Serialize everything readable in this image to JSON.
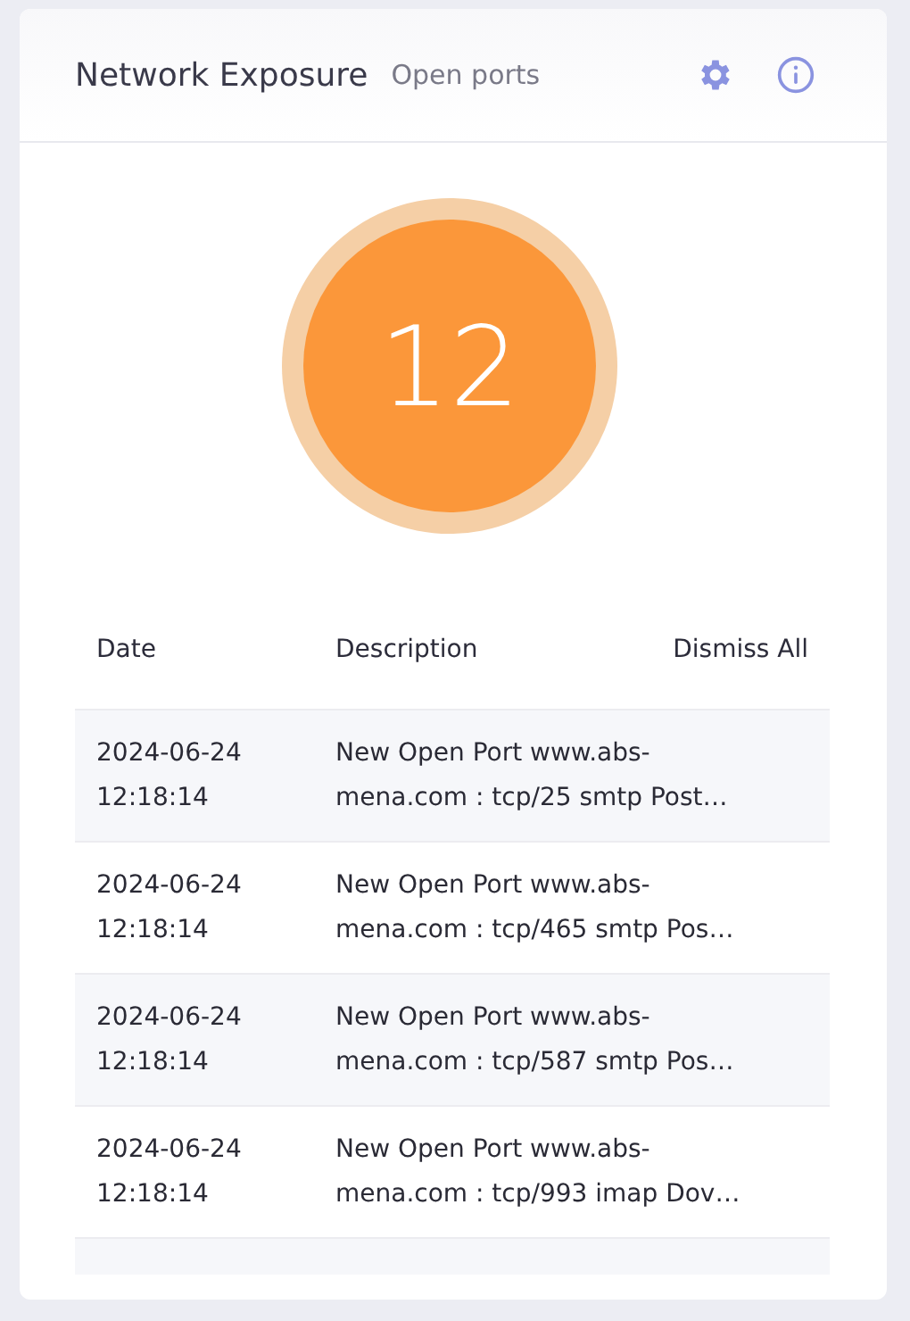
{
  "header": {
    "title": "Network Exposure",
    "subtitle": "Open ports"
  },
  "counter": {
    "value": "12"
  },
  "table": {
    "columns": [
      "Date",
      "Description"
    ],
    "action": "Dismiss All",
    "rows": [
      {
        "date": "2024-06-24 12:18:14",
        "description": "New Open Port www.abs-mena.com : tcp/25 smtp Post…"
      },
      {
        "date": "2024-06-24 12:18:14",
        "description": "New Open Port www.abs-mena.com : tcp/465 smtp Pos…"
      },
      {
        "date": "2024-06-24 12:18:14",
        "description": "New Open Port www.abs-mena.com : tcp/587 smtp Pos…"
      },
      {
        "date": "2024-06-24 12:18:14",
        "description": "New Open Port www.abs-mena.com : tcp/993 imap Dov…"
      }
    ]
  }
}
